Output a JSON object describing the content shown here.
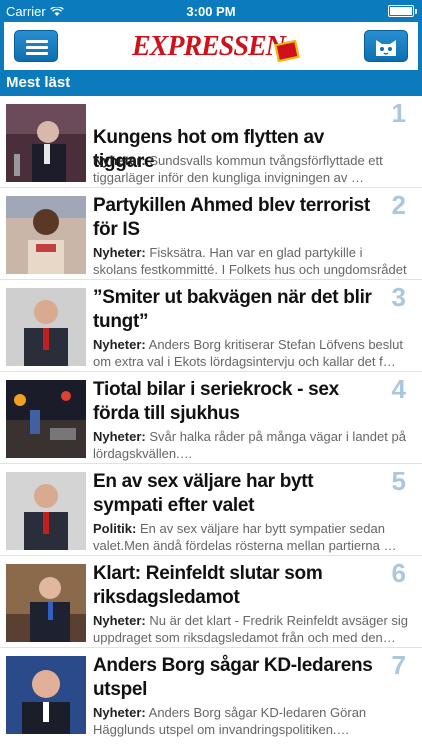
{
  "status": {
    "carrier": "Carrier",
    "time": "3:00 PM"
  },
  "header": {
    "logo": "EXPRESSEN",
    "menu_icon": "hamburger-icon",
    "kids_icon": "cat-face-icon"
  },
  "section": {
    "title": "Mest läst"
  },
  "articles": [
    {
      "rank": "1",
      "title": "Kungens hot om flytten av tiggare",
      "category": "Nyheter:",
      "summary": "Sundsvalls kommun tvångsförflyttade ett tiggarläger inför den kungliga invigningen av …"
    },
    {
      "rank": "2",
      "title": "Partykillen Ahmed blev terrorist för IS",
      "category": "Nyheter:",
      "summary": "Fisksätra. Han var en glad partykille i skolans festkommitté. I Folkets hus och ungdomsrådet i …"
    },
    {
      "rank": "3",
      "title": "”Smiter ut bakvägen när det blir tungt”",
      "category": "Nyheter:",
      "summary": "Anders Borg kritiserar Stefan Löfvens beslut om extra val i Ekots lördagsintervju och kallar det f…"
    },
    {
      "rank": "4",
      "title": "Tiotal bilar i seriekrock - sex förda till sjukhus",
      "category": "Nyheter:",
      "summary": "Svår halka råder på många vägar i landet på lördagskvällen.…"
    },
    {
      "rank": "5",
      "title": "En av sex väljare har bytt sympati efter valet",
      "category": "Politik:",
      "summary": "En av sex väljare har bytt sympatier sedan valet.Men ändå fördelas rösterna mellan partierna …"
    },
    {
      "rank": "6",
      "title": "Klart: Reinfeldt slutar som riksdagsledamot",
      "category": "Nyheter:",
      "summary": "Nu är det klart - Fredrik Reinfeldt avsäger sig uppdraget som riksdagsledamot från och med den…"
    },
    {
      "rank": "7",
      "title": "Anders Borg sågar KD-ledarens utspel",
      "category": "Nyheter:",
      "summary": "Anders Borg sågar KD-ledaren Göran Hägglunds utspel om invandringspolitiken.…"
    }
  ]
}
